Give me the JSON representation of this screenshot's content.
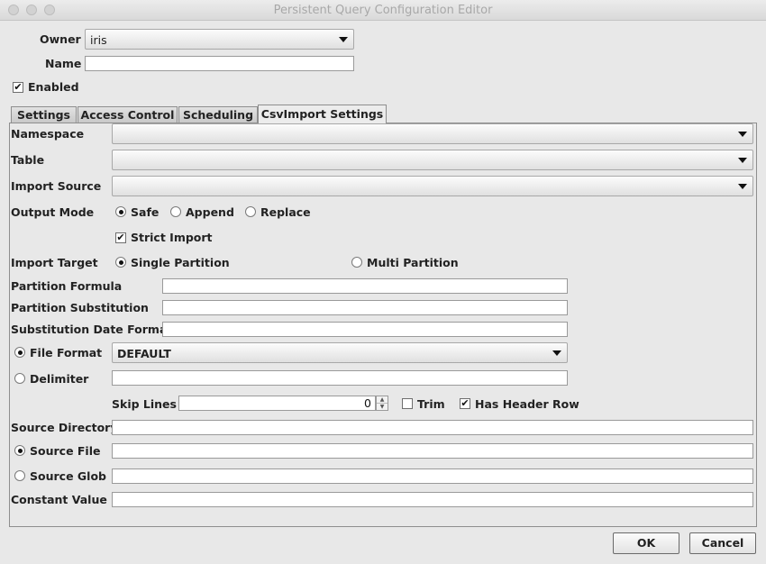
{
  "window": {
    "title": "Persistent Query Configuration Editor"
  },
  "owner": {
    "label": "Owner",
    "value": "iris"
  },
  "name": {
    "label": "Name",
    "value": ""
  },
  "enabled": {
    "label": "Enabled",
    "checked": true
  },
  "tabs": [
    {
      "label": "Settings",
      "active": false
    },
    {
      "label": "Access Control",
      "active": false
    },
    {
      "label": "Scheduling",
      "active": false
    },
    {
      "label": "CsvImport Settings",
      "active": true
    }
  ],
  "csv": {
    "namespace": {
      "label": "Namespace",
      "value": ""
    },
    "table": {
      "label": "Table",
      "value": ""
    },
    "import_source": {
      "label": "Import Source",
      "value": ""
    },
    "output_mode": {
      "label": "Output Mode",
      "options": [
        "Safe",
        "Append",
        "Replace"
      ],
      "selected": "Safe"
    },
    "strict_import": {
      "label": "Strict Import",
      "checked": true
    },
    "import_target": {
      "label": "Import Target",
      "options": [
        "Single Partition",
        "Multi Partition"
      ],
      "selected": "Single Partition"
    },
    "partition_formula": {
      "label": "Partition Formula",
      "value": ""
    },
    "partition_substitution": {
      "label": "Partition Substitution",
      "value": ""
    },
    "substitution_date_format": {
      "label": "Substitution Date Format",
      "value": ""
    },
    "file_format": {
      "label": "File Format",
      "selected": true,
      "value": "DEFAULT"
    },
    "delimiter": {
      "label": "Delimiter",
      "selected": false,
      "value": ""
    },
    "skip_lines": {
      "label": "Skip Lines",
      "value": "0"
    },
    "trim": {
      "label": "Trim",
      "checked": false
    },
    "has_header_row": {
      "label": "Has Header Row",
      "checked": true
    },
    "source_directory": {
      "label": "Source Directory",
      "value": ""
    },
    "source_file": {
      "label": "Source File",
      "selected": true,
      "value": ""
    },
    "source_glob": {
      "label": "Source Glob",
      "selected": false,
      "value": ""
    },
    "constant_value": {
      "label": "Constant Value",
      "value": ""
    }
  },
  "buttons": {
    "ok": "OK",
    "cancel": "Cancel"
  },
  "glyphs": {
    "check": "✔",
    "spin_up": "▲",
    "spin_down": "▼"
  }
}
